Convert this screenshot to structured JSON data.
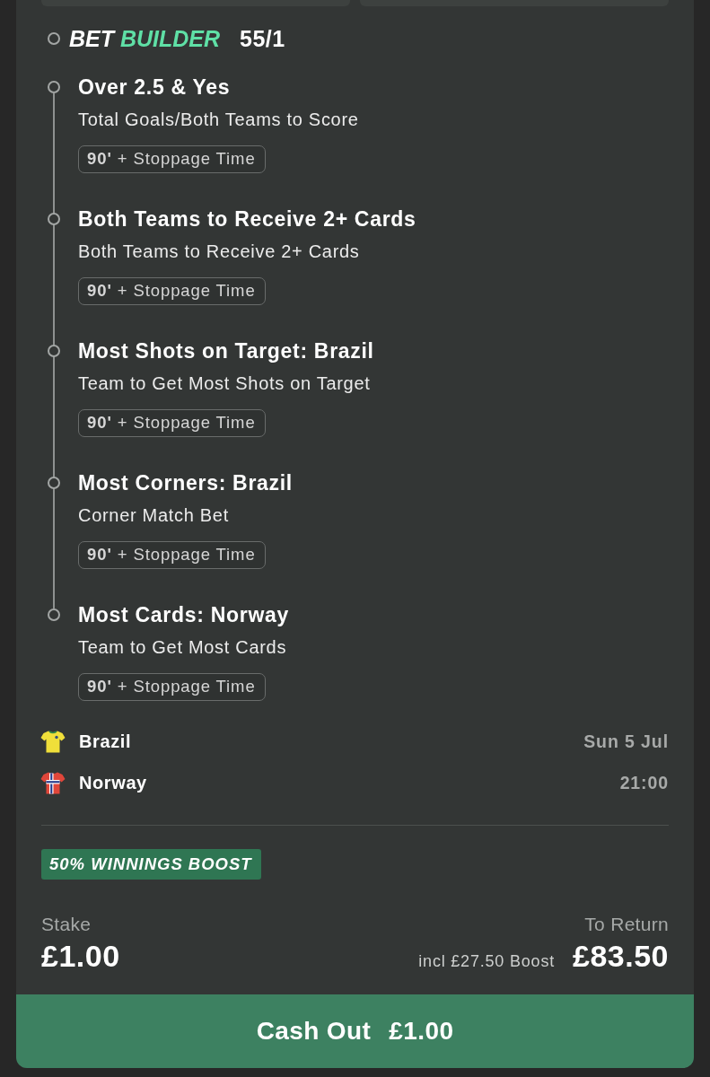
{
  "header": {
    "title_first": "BET",
    "title_accent": "BUILDER",
    "odds": "55/1"
  },
  "legs": [
    {
      "selection": "Over 2.5 & Yes",
      "market": "Total Goals/Both Teams to Score",
      "period": "**90'** + Stoppage Time"
    },
    {
      "selection": "Both Teams to Receive 2+ Cards",
      "market": "Both Teams to Receive 2+ Cards",
      "period": "**90'** + Stoppage Time"
    },
    {
      "selection": "Most Shots on Target: Brazil",
      "market": "Team to Get Most Shots on Target",
      "period": "**90'** + Stoppage Time"
    },
    {
      "selection": "Most Corners: Brazil",
      "market": "Corner Match Bet",
      "period": "**90'** + Stoppage Time"
    },
    {
      "selection": "Most Cards: Norway",
      "market": "Team to Get Most Cards",
      "period": "**90'** + Stoppage Time"
    }
  ],
  "teams": [
    {
      "name": "Brazil",
      "detail": "Sun 5 Jul",
      "kind": "plain",
      "color": "#f0df3a"
    },
    {
      "name": "Norway",
      "detail": "21:00",
      "kind": "cross",
      "color": "#e0463a"
    }
  ],
  "boost": {
    "label": "50% WINNINGS BOOST"
  },
  "stake": {
    "label": "Stake",
    "value": "£1.00"
  },
  "returns": {
    "label": "To Return",
    "note": "incl £27.50 Boost",
    "value": "£83.50"
  },
  "cash_out": {
    "label": "Cash Out",
    "amount": "£1.00"
  }
}
